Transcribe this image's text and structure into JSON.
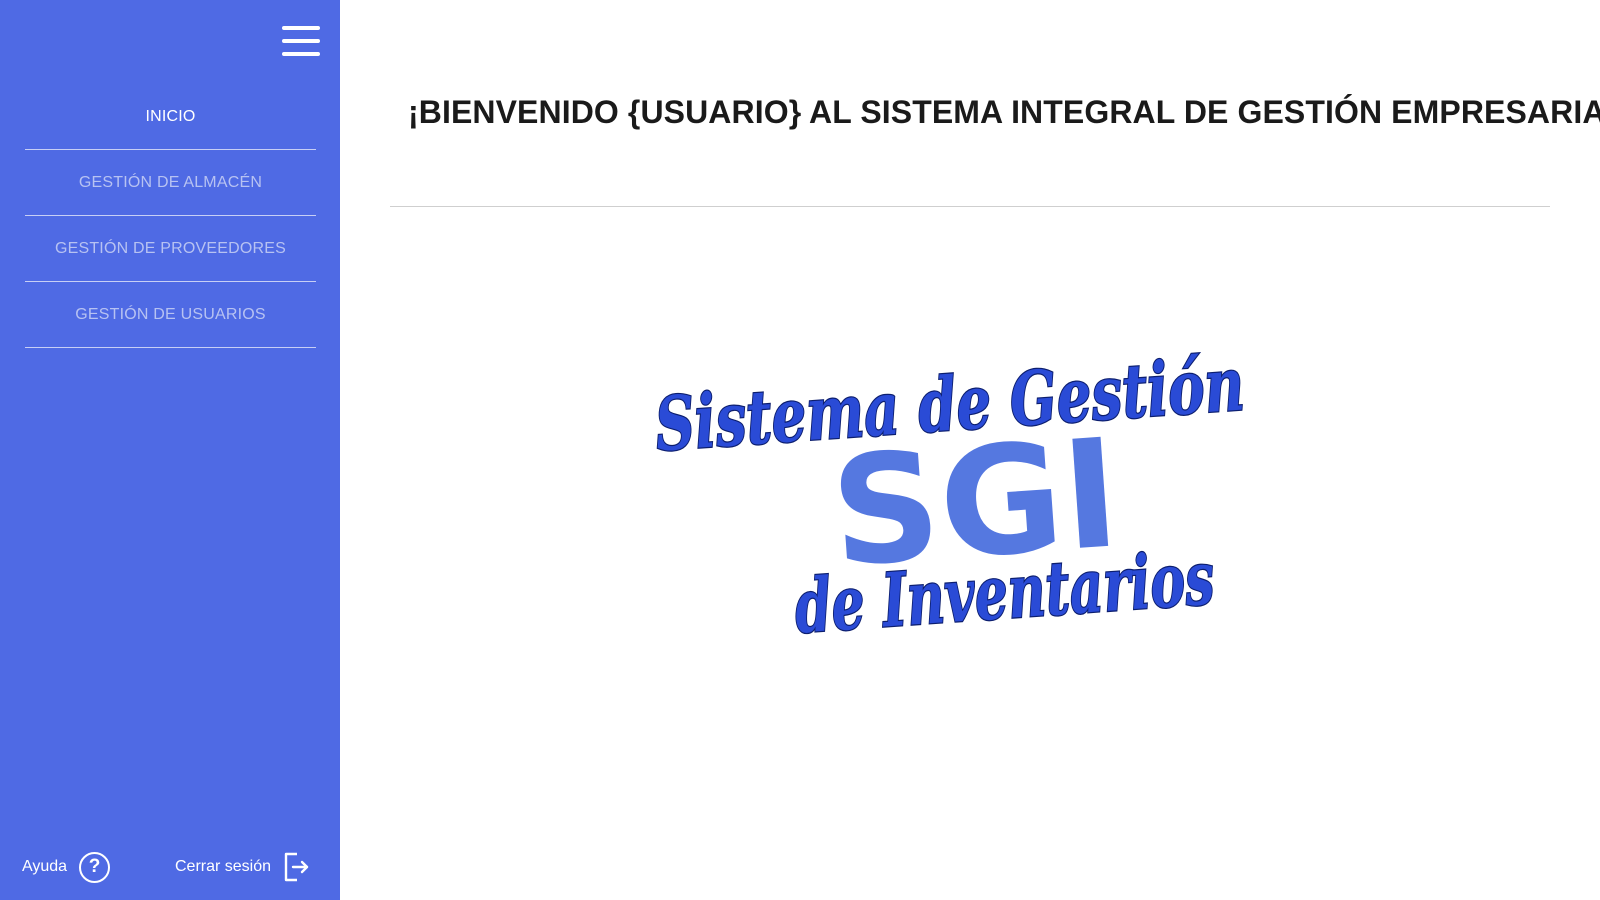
{
  "sidebar": {
    "nav": [
      {
        "label": "INICIO",
        "active": true
      },
      {
        "label": "GESTIÓN DE ALMACÉN",
        "active": false
      },
      {
        "label": "GESTIÓN DE PROVEEDORES",
        "active": false
      },
      {
        "label": "GESTIÓN DE USUARIOS",
        "active": false
      }
    ],
    "footer": {
      "help_label": "Ayuda",
      "help_icon": "question-circle-icon",
      "logout_label": "Cerrar sesión",
      "logout_icon": "logout-icon"
    },
    "menu_icon": "hamburger-menu-icon"
  },
  "main": {
    "welcome": "¡BIENVENIDO {USUARIO} AL SISTEMA INTEGRAL DE GESTIÓN EMPRESARIAL!",
    "logo": {
      "line1": "Sistema de Gestión",
      "line2": "SGI",
      "line3": "de Inventarios"
    }
  },
  "colors": {
    "sidebar_bg": "#4f6ae4",
    "nav_inactive": "#b7c2f2",
    "nav_active": "#ffffff",
    "logo_script": "#2a4bd6",
    "logo_block": "#5578e0"
  }
}
